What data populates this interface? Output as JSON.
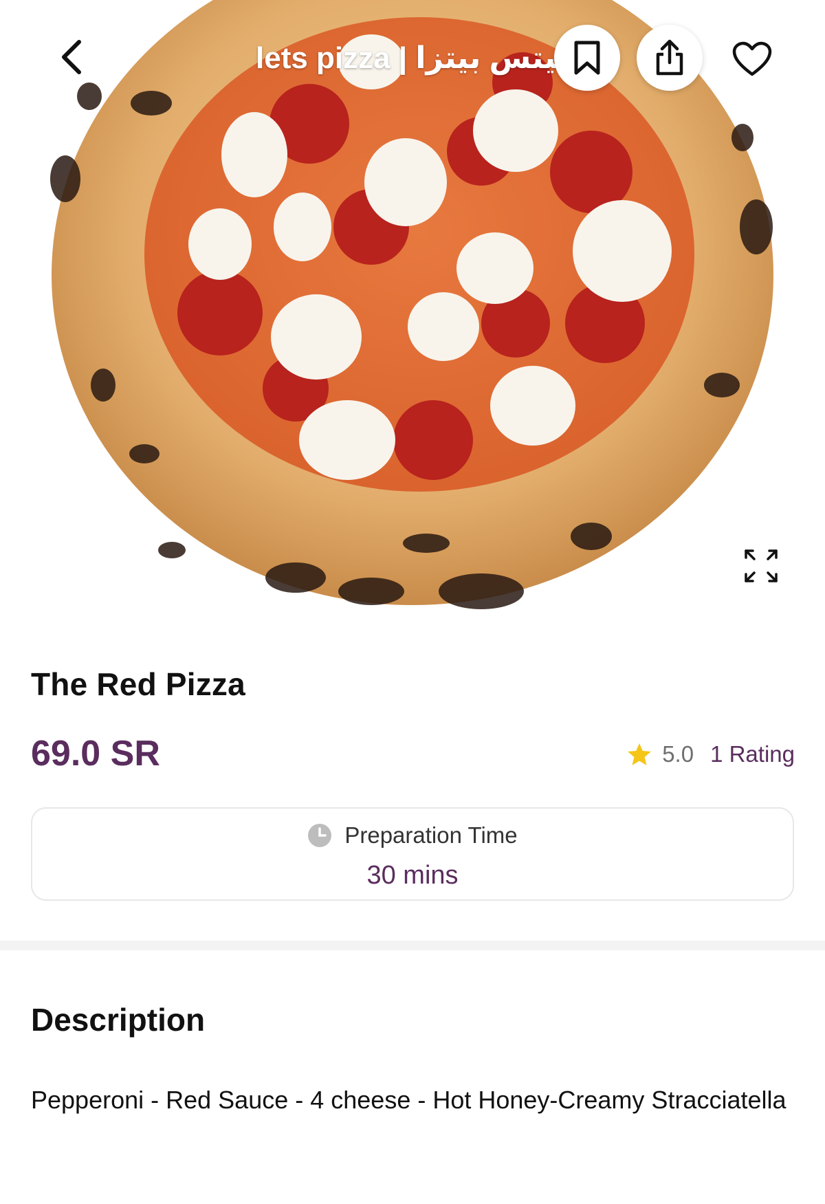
{
  "header": {
    "store_name": "lets pizza | ليتس بيتزا",
    "back_icon": "chevron-left-icon",
    "bookmark_icon": "bookmark-icon",
    "share_icon": "share-icon",
    "favorite_icon": "heart-icon",
    "expand_icon": "expand-icon"
  },
  "product": {
    "title": "The Red Pizza",
    "price": "69.0 SR",
    "rating_score": "5.0",
    "rating_count": "1 Rating"
  },
  "prep": {
    "label": "Preparation Time",
    "value": "30 mins"
  },
  "description": {
    "title": "Description",
    "text": "Pepperoni - Red Sauce - 4 cheese - Hot Honey-Creamy Stracciatella"
  },
  "colors": {
    "accent": "#5a2d5e",
    "star": "#f5c518",
    "divider": "#f3f3f3"
  }
}
